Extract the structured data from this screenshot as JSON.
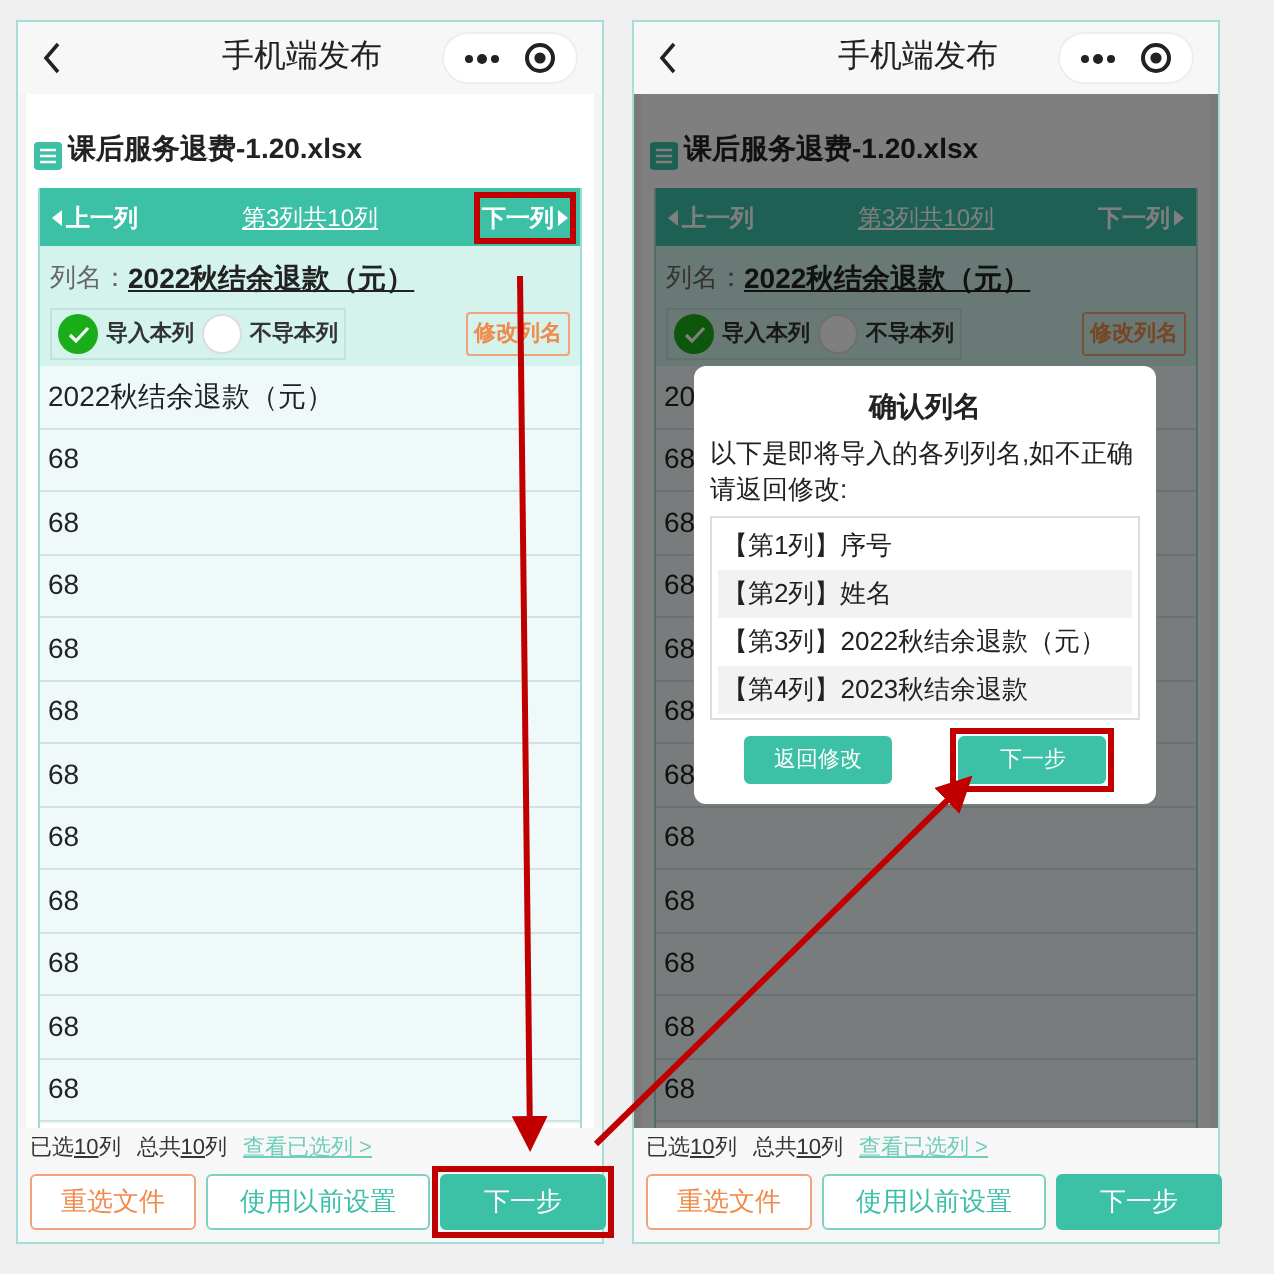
{
  "panels": [
    {
      "header": {
        "title": "手机端发布"
      },
      "file_name": "课后服务退费-1.20.xlsx",
      "nav": {
        "prev": "上一列",
        "position": "第3列共10列",
        "next": "下一列",
        "next_highlighted": true
      },
      "column_name": {
        "label": "列名：",
        "value": "2022秋结余退款（元）"
      },
      "options": [
        {
          "label": "导入本列",
          "selected": true
        },
        {
          "label": "不导本列",
          "selected": false
        }
      ],
      "rename_button": "修改列名",
      "rows": [
        "2022秋结余退款（元）",
        "68",
        "68",
        "68",
        "68",
        "68",
        "68",
        "68",
        "68",
        "68",
        "68",
        "68"
      ],
      "summary": [
        {
          "prefix": "已选",
          "count": "10",
          "suffix": "列"
        },
        {
          "prefix": "总共",
          "count": "10",
          "suffix": "列"
        }
      ],
      "summary_link": "查看已选列 >",
      "buttons": [
        {
          "label": "重选文件",
          "kind": "warning",
          "highlighted": false
        },
        {
          "label": "使用以前设置",
          "kind": "outline",
          "highlighted": false
        },
        {
          "label": "下一步",
          "kind": "primary",
          "highlighted": true
        }
      ]
    },
    {
      "header": {
        "title": "手机端发布"
      },
      "file_name": "课后服务退费-1.20.xlsx",
      "nav": {
        "prev": "上一列",
        "position": "第3列共10列",
        "next": "下一列",
        "next_highlighted": false
      },
      "column_name": {
        "label": "列名：",
        "value": "2022秋结余退款（元）"
      },
      "options": [
        {
          "label": "导入本列",
          "selected": true
        },
        {
          "label": "不导本列",
          "selected": false
        }
      ],
      "rename_button": "修改列名",
      "rows": [
        "20",
        "68",
        "68",
        "68",
        "68",
        "68",
        "68",
        "68",
        "68",
        "68",
        "68",
        "68"
      ],
      "summary": [
        {
          "prefix": "已选",
          "count": "10",
          "suffix": "列"
        },
        {
          "prefix": "总共",
          "count": "10",
          "suffix": "列"
        }
      ],
      "summary_link": "查看已选列 >",
      "buttons": [
        {
          "label": "重选文件",
          "kind": "warning",
          "highlighted": false
        },
        {
          "label": "使用以前设置",
          "kind": "outline",
          "highlighted": false
        },
        {
          "label": "下一步",
          "kind": "primary",
          "highlighted": false
        }
      ],
      "dialog": {
        "title": "确认列名",
        "message": "以下是即将导入的各列列名,如不正确请返回修改:",
        "items": [
          "【第1列】序号",
          "【第2列】姓名",
          "【第3列】2022秋结余退款（元）",
          "【第4列】2023秋结余退款"
        ],
        "buttons": [
          {
            "label": "返回修改",
            "highlighted": false
          },
          {
            "label": "下一步",
            "highlighted": true
          }
        ]
      }
    }
  ]
}
